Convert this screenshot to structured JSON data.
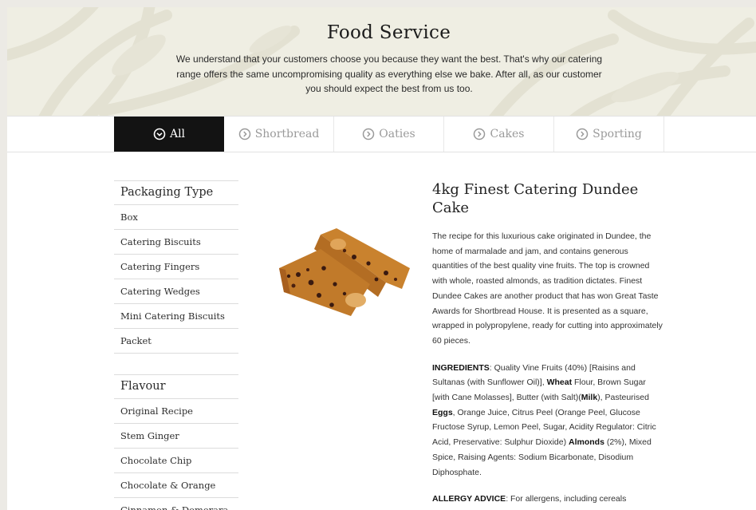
{
  "hero": {
    "title": "Food Service",
    "text": "We understand that your customers choose you because they want the best. That's why our catering range offers the same uncompromising quality as everything else we bake. After all, as our customer you should expect the best from us too."
  },
  "tabs": [
    {
      "label": "All",
      "active": true
    },
    {
      "label": "Shortbread",
      "active": false
    },
    {
      "label": "Oaties",
      "active": false
    },
    {
      "label": "Cakes",
      "active": false
    },
    {
      "label": "Sporting",
      "active": false
    }
  ],
  "sidebar": {
    "packaging": {
      "title": "Packaging Type",
      "items": [
        "Box",
        "Catering Biscuits",
        "Catering Fingers",
        "Catering Wedges",
        "Mini Catering Biscuits",
        "Packet"
      ]
    },
    "flavour": {
      "title": "Flavour",
      "items": [
        "Original Recipe",
        "Stem Ginger",
        "Chocolate Chip",
        "Chocolate & Orange",
        "Cinnamon & Demerara"
      ]
    }
  },
  "product": {
    "title": "4kg Finest Catering Dundee Cake",
    "description": "The recipe for this luxurious cake originated in Dundee, the home of marmalade and jam, and contains generous quantities of the best quality vine fruits. The top is crowned with whole, roasted almonds, as tradition dictates. Finest Dundee Cakes are another product that has won Great Taste Awards for Shortbread House. It is presented as a square, wrapped in polypropylene, ready for cutting into approximately 60 pieces.",
    "ingredients_label": "INGREDIENTS",
    "ing_1": ": Quality Vine Fruits (40%) [Raisins and Sultanas (with Sunflower Oil)], ",
    "ing_wheat": "Wheat",
    "ing_2": " Flour, Brown Sugar [with Cane Molasses], Butter (with Salt)(",
    "ing_milk": "Milk",
    "ing_3": "), Pasteurised ",
    "ing_eggs": "Eggs",
    "ing_4": ", Orange Juice, Citrus Peel (Orange Peel, Glucose Fructose Syrup, Lemon Peel, Sugar, Acidity Regulator: Citric Acid, Preservative: Sulphur Dioxide) ",
    "ing_almonds": "Almonds",
    "ing_5": " (2%), Mixed Spice, Raising Agents: Sodium Bicarbonate, Disodium Diphosphate.",
    "allergy_label": "ALLERGY ADVICE",
    "allergy_text": ": For allergens, including cereals"
  },
  "colors": {
    "hero_bg": "#efeee3",
    "active_tab": "#131313",
    "tab_text": "#9a9a9a"
  },
  "icons": {
    "tab_active": "chevron-down-circle-icon",
    "tab_inactive": "chevron-right-circle-icon"
  }
}
